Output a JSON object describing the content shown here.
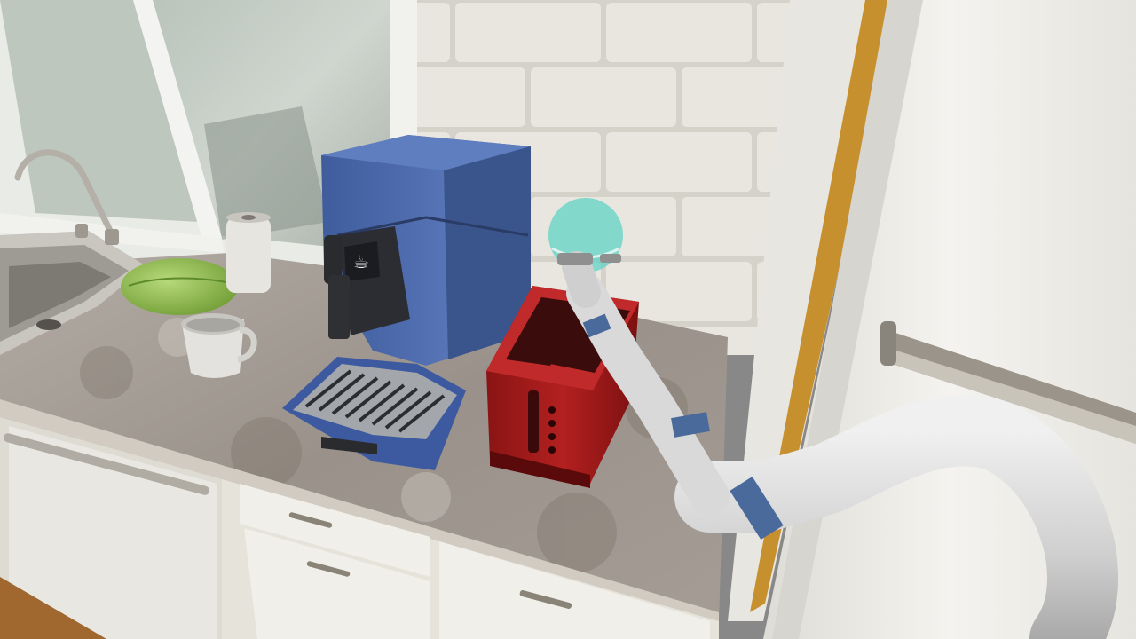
{
  "scene": {
    "type": "3d-rendered-kitchen-robot-simulation",
    "objects": [
      "window",
      "faucet",
      "sink",
      "lettuce",
      "paper-towel-roll",
      "mug",
      "coffee-machine",
      "toaster",
      "robot-arm",
      "refrigerator",
      "countertop",
      "cabinet-drawers",
      "dishwasher",
      "tile-backsplash"
    ],
    "colors": {
      "coffee_machine": "#4a67a8",
      "toaster": "#a51c1c",
      "target_marker": "#5fd3c4",
      "robot_band": "#4a6a9c",
      "robot_body": "#d9d9d9",
      "tile": "#e6e3dc",
      "counter": "#9c948c",
      "fridge": "#efeeea",
      "cabinet": "#ece9e1",
      "floor": "#a0672e",
      "lettuce": "#8fbf4f"
    }
  }
}
